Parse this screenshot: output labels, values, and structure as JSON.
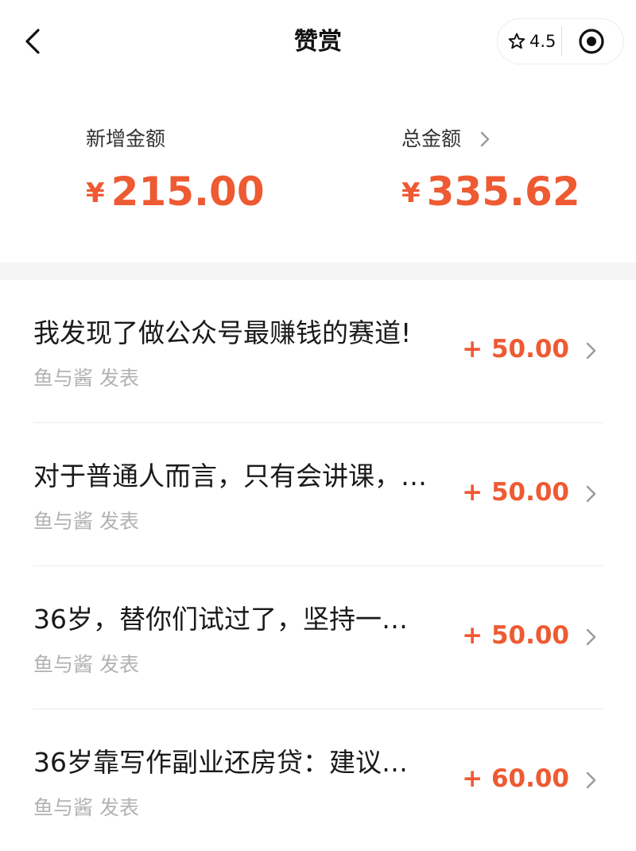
{
  "header": {
    "title": "赞赏",
    "rating": "4.5",
    "back_icon": "back-arrow-icon",
    "star_icon": "star-icon",
    "target_icon": "target-icon"
  },
  "summary": {
    "new_label": "新增金额",
    "new_currency": "¥",
    "new_amount": "215.00",
    "total_label": "总金额",
    "total_currency": "¥",
    "total_amount": "335.62"
  },
  "articles": [
    {
      "title": "我发现了做公众号最赚钱的赛道!",
      "meta": "鱼与酱 发表",
      "amount": "+ 50.00"
    },
    {
      "title": "对于普通人而言，只有会讲课，…",
      "meta": "鱼与酱 发表",
      "amount": "+ 50.00"
    },
    {
      "title": "36岁，替你们试过了，坚持一…",
      "meta": "鱼与酱 发表",
      "amount": "+ 50.00"
    },
    {
      "title": "36岁靠写作副业还房贷：建议…",
      "meta": "鱼与酱 发表",
      "amount": "+ 60.00"
    }
  ],
  "colors": {
    "accent": "#ee5a32",
    "text": "#1a1a1a",
    "muted": "#b2b2b2",
    "divider": "#ececec",
    "gap": "#f5f5f5"
  }
}
